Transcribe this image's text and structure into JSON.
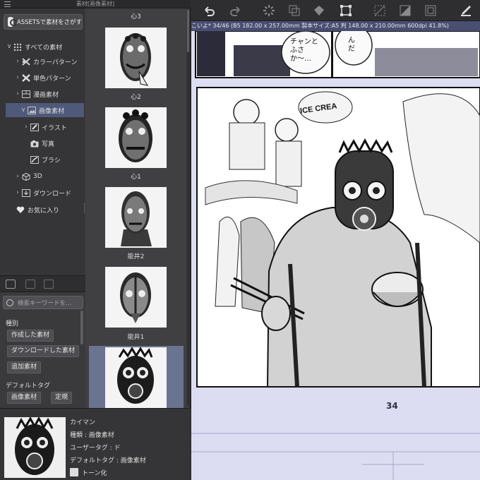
{
  "panel": {
    "title": "素材[画像素材]",
    "assets_button": "ASSETSで素材をさがす",
    "tree": [
      {
        "label": "すべての素材",
        "expand": "∨",
        "level": 0
      },
      {
        "label": "カラーパターン",
        "expand": "›",
        "level": 1
      },
      {
        "label": "単色パターン",
        "expand": "›",
        "level": 1
      },
      {
        "label": "漫画素材",
        "expand": "›",
        "level": 1
      },
      {
        "label": "画像素材",
        "expand": "∨",
        "level": 1,
        "selected": true
      },
      {
        "label": "イラスト",
        "expand": "›",
        "level": 2
      },
      {
        "label": "写真",
        "expand": "",
        "level": 2
      },
      {
        "label": "ブラシ",
        "expand": "",
        "level": 2
      },
      {
        "label": "3D",
        "expand": "›",
        "level": 1
      },
      {
        "label": "ダウンロード",
        "expand": "›",
        "level": 1
      },
      {
        "label": "お気に入り",
        "expand": "",
        "level": 0
      }
    ],
    "search_placeholder": "検索キーワードを…",
    "filter_heading": "種別",
    "filter_buttons": [
      "作成した素材",
      "ダウンロードした素材",
      "追加素材"
    ],
    "default_tag_heading": "デフォルトタグ",
    "default_tag_buttons": [
      "画像素材",
      "定規"
    ]
  },
  "thumbnails": [
    {
      "label": "心3"
    },
    {
      "label": "心2"
    },
    {
      "label": "心1"
    },
    {
      "label": "能井2"
    },
    {
      "label": "能井1"
    },
    {
      "label": ""
    }
  ],
  "detail": {
    "name": "カイマン",
    "kind": "種類 : 画像素材",
    "user_tag": "ユーザータグ : ド",
    "default_tag": "デフォルトタグ : 画像素材",
    "tone_label": "トーン化"
  },
  "canvas": {
    "infobar": "こいよ* 34/46 (B5 182.00 x 257.00mm 製本サイズ:A5 判 148.00 x 210.00mm 600dpi 41.8%)",
    "page_number": "34",
    "icecream_sign": "ICE CREA",
    "balloon_left": "チャンと\nふさか〜…",
    "balloon_right": "んだ"
  },
  "colors": {
    "panel_bg": "#3a3a3c",
    "selection": "#4f5a7a",
    "infobar": "#4a4f72",
    "canvas_bg": "#d8d8f0"
  }
}
